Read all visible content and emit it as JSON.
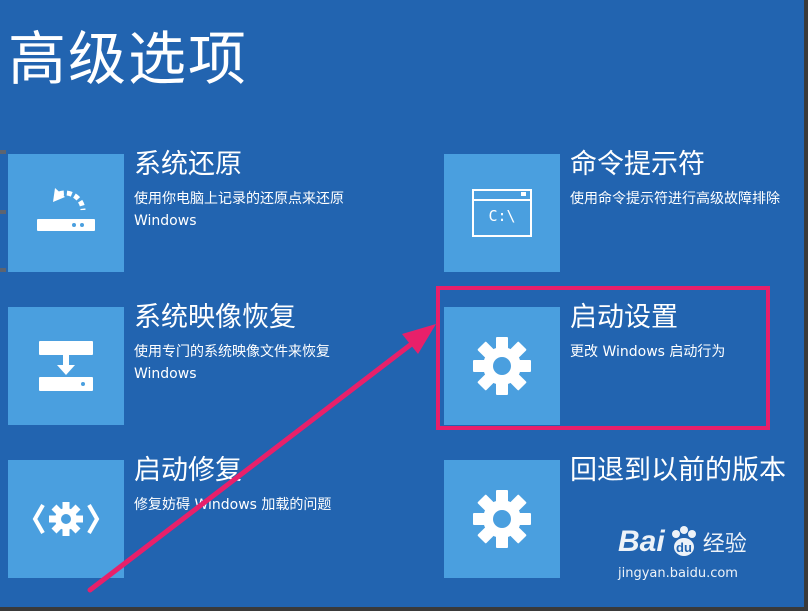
{
  "page_title": "高级选项",
  "options": [
    {
      "title": "系统还原",
      "desc1": "使用你电脑上记录的还原点来还原",
      "desc2": "Windows",
      "icon": "system-restore-icon"
    },
    {
      "title": "命令提示符",
      "desc1": "使用命令提示符进行高级故障排除",
      "desc2": "",
      "icon": "command-prompt-icon",
      "icon_text": "C:\\"
    },
    {
      "title": "系统映像恢复",
      "desc1": "使用专门的系统映像文件来恢复",
      "desc2": "Windows",
      "icon": "system-image-recovery-icon"
    },
    {
      "title": "启动设置",
      "desc1": "更改 Windows 启动行为",
      "desc2": "",
      "icon": "gear-icon"
    },
    {
      "title": "启动修复",
      "desc1": "修复妨碍 Windows 加载的问题",
      "desc2": "",
      "icon": "startup-repair-icon"
    },
    {
      "title": "回退到以前的版本",
      "desc1": "",
      "desc2": "",
      "icon": "gear-icon"
    }
  ],
  "colors": {
    "background": "#2264b0",
    "tile": "#4a9fdf",
    "highlight": "#e8206a"
  },
  "watermark": {
    "brand": "Bai",
    "brand_suffix": "经验",
    "url": "jingyan.baidu.com"
  }
}
